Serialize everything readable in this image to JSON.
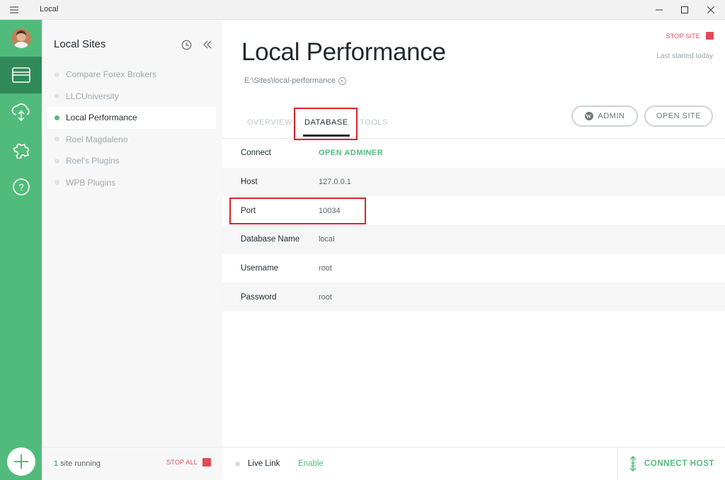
{
  "window": {
    "title": "Local",
    "controls": [
      "minimize-icon",
      "maximize-icon",
      "close-icon"
    ]
  },
  "rail": {
    "items": [
      {
        "name": "sites",
        "icon": "sites-icon",
        "active": true
      },
      {
        "name": "connect",
        "icon": "cloud-icon",
        "active": false
      },
      {
        "name": "addons",
        "icon": "puzzle-icon",
        "active": false
      },
      {
        "name": "help",
        "icon": "help-icon",
        "active": false
      }
    ],
    "add_icon": "plus-icon"
  },
  "sidebar": {
    "title": "Local Sites",
    "sites": [
      {
        "label": "Compare Forex Brokers",
        "active": false
      },
      {
        "label": "LLCUniversity",
        "active": false
      },
      {
        "label": "Local Performance",
        "active": true
      },
      {
        "label": "Roel Magdaleno",
        "active": false
      },
      {
        "label": "Roel's Plugins",
        "active": false
      },
      {
        "label": "WPB Plugins",
        "active": false
      }
    ],
    "footer": {
      "running_count": "1",
      "running_text": " site running",
      "stop_all": "STOP ALL"
    }
  },
  "site": {
    "title": "Local Performance",
    "stop_label": "STOP SITE",
    "last_started": "Last started today",
    "path": "E:\\Sites\\local-performance"
  },
  "tabs": [
    {
      "label": "OVERVIEW",
      "active": false
    },
    {
      "label": "DATABASE",
      "active": true
    },
    {
      "label": "TOOLS",
      "active": false
    }
  ],
  "actions": {
    "admin": "ADMIN",
    "open_site": "OPEN SITE"
  },
  "database": {
    "rows": [
      {
        "label": "Connect",
        "value": "OPEN ADMINER",
        "link": true
      },
      {
        "label": "Host",
        "value": "127.0.0.1",
        "link": false
      },
      {
        "label": "Port",
        "value": "10034",
        "link": false
      },
      {
        "label": "Database Name",
        "value": "local",
        "link": false
      },
      {
        "label": "Username",
        "value": "root",
        "link": false
      },
      {
        "label": "Password",
        "value": "root",
        "link": false
      }
    ]
  },
  "footer": {
    "live_link": "Live Link",
    "enable": "Enable",
    "connect_host": "CONNECT HOST"
  },
  "colors": {
    "accent": "#51bb7b",
    "rail_active": "#2f8a57",
    "danger": "#e14a58",
    "highlight": "#d9232d"
  }
}
